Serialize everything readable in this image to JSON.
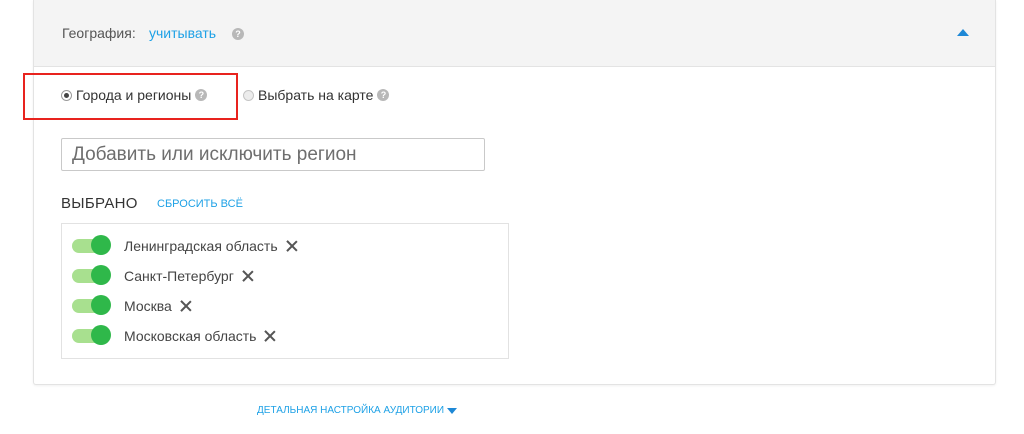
{
  "geography": {
    "label": "География:",
    "value": "учитывать",
    "help_icon": "question-icon"
  },
  "radios": [
    {
      "label": "Города и регионы",
      "checked": true
    },
    {
      "label": "Выбрать на карте",
      "checked": false
    }
  ],
  "search": {
    "placeholder": "Добавить или исключить регион",
    "value": ""
  },
  "selected": {
    "title": "ВЫБРАНО",
    "reset_label": "СБРОСИТЬ ВСЁ",
    "items": [
      {
        "label": "Ленинградская область",
        "enabled": true
      },
      {
        "label": "Санкт-Петербург",
        "enabled": true
      },
      {
        "label": "Москва",
        "enabled": true
      },
      {
        "label": "Московская область",
        "enabled": true
      }
    ]
  },
  "footer": {
    "detail_label": "ДЕТАЛЬНАЯ НАСТРОЙКА АУДИТОРИИ"
  },
  "colors": {
    "accent": "#1ea1e6",
    "toggle_on": "#2fb84a",
    "highlight": "#e8231e"
  }
}
